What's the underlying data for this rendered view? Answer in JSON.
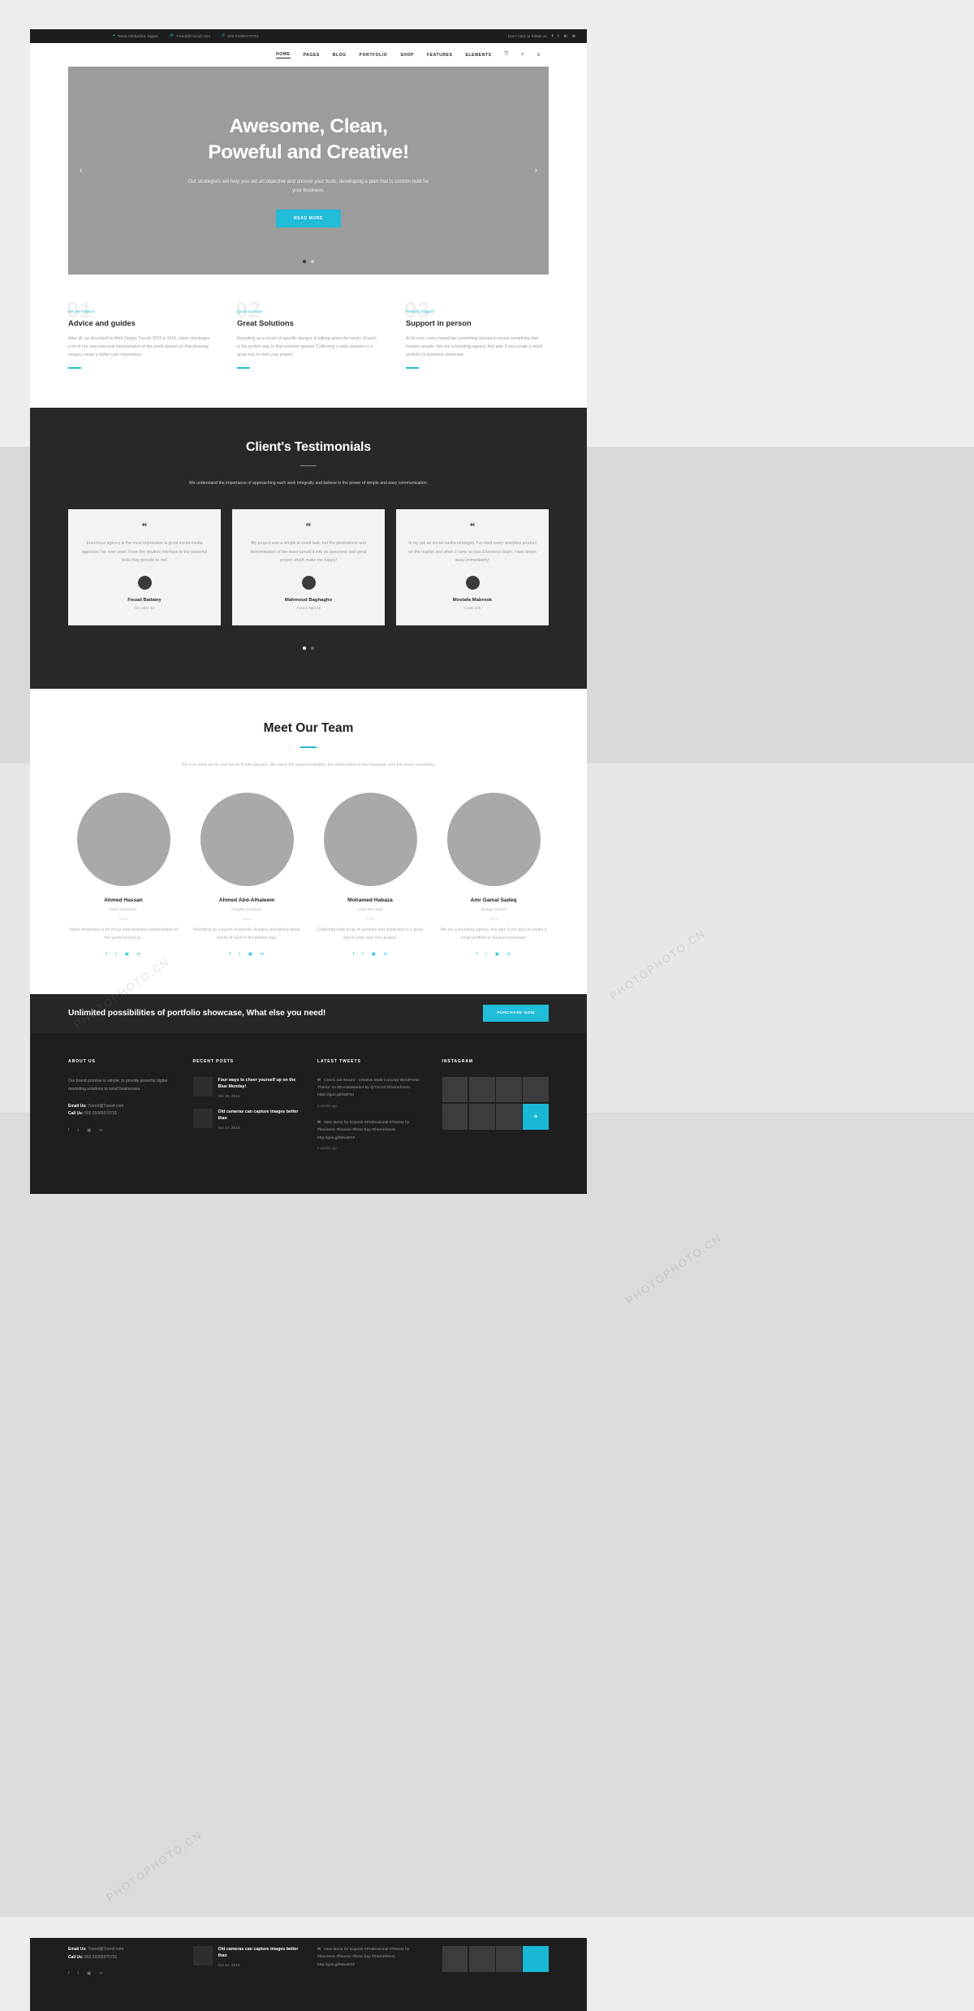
{
  "topbar": {
    "location": "Tanta AlGharbia, Egypt.",
    "email": "7oroof@7oroof.com",
    "phone": "002 01065370701",
    "follow_label": "Don't miss to follow us",
    "socials": [
      "f",
      "t",
      "in",
      "❈"
    ],
    "icons": {
      "pin": "⌖",
      "mail": "✉",
      "phone": "✆"
    }
  },
  "nav": {
    "items": [
      {
        "label": "HOME",
        "active": true
      },
      {
        "label": "PAGES",
        "active": false
      },
      {
        "label": "BLOG",
        "active": false
      },
      {
        "label": "PORTFOLIO",
        "active": false
      },
      {
        "label": "SHOP",
        "active": false
      },
      {
        "label": "FEATURES",
        "active": false
      },
      {
        "label": "ELEMENTS",
        "active": false
      }
    ],
    "cart_icon": "⛉",
    "search_icon": "⌕",
    "menu_icon": "≡"
  },
  "hero": {
    "title_line1": "Awesome, Clean,",
    "title_line2": "Poweful and Creative!",
    "subtitle": "Our strategists will help you set an objective and choose your tools, developing a plan that is custom-built for your business.",
    "button": "READ MORE",
    "arrow_prev": "‹",
    "arrow_next": "›",
    "dots": 2,
    "active_dot": 0,
    "accent": "#21bcd8"
  },
  "features": [
    {
      "number": "01",
      "tag": "We are helpers",
      "title": "Advice and guides",
      "text": "After all, as described in Web Design Trends 2015 & 2016, vision dominates a lot of our subconscious interpretation of the world around us that pleasing images create a better user experience."
    },
    {
      "number": "02",
      "tag": "Quick & smart",
      "title": "Great Solutions",
      "text": "Rounding up a bunch of specific designs & talking about the merits of each is the perfect way to find common ground. Collecting a wide samples is a great way to start your project."
    },
    {
      "number": "03",
      "tag": "Friendly support",
      "title": "Support in person",
      "text": "At its core, every brand has something special to reveal something that inspires people. We are a branding agency, this plan if you create a small portfolio or business showcase."
    }
  ],
  "testimonials": {
    "heading": "Client's Testimonials",
    "subtitle": "We understand the importance of approaching each work integrally and believe in the power of simple and easy communication.",
    "quote_glyph": "“",
    "cards": [
      {
        "text": "Enormous agency is the most impressive & great social media agencies I've ever seen. From the intuitive interface to the powerful tools they provide to me!",
        "name": "Fouad Badawy",
        "role": "Tie Labs Inc"
      },
      {
        "text": "My project was a simple & small task, but the persistence and determination of the team turned it into an awesome and great project which make me happy!",
        "name": "Mahmoud Baghagho",
        "role": "7oroof Agency"
      },
      {
        "text": "In my job as social media strategist, I've tried every analytics product on the market and when I came across Enormous team, I was blown away immediately!",
        "name": "Mostafa Mabrook",
        "role": "Code 125"
      }
    ],
    "dots": 2,
    "active_dot": 0
  },
  "team": {
    "heading": "Meet Our Team",
    "subtitle": "We love what we do and we do it with passion. We value the experimentation, the reformation of the message, and the smart incentives.",
    "members": [
      {
        "name": "Ahmed Hassan",
        "job": "Web developer",
        "bio": "Vision dominates a lot of our subconscious interpretation of the world around us."
      },
      {
        "name": "Ahmed Abd-Alhaleem",
        "job": "Graphic Designer",
        "bio": "Rounding up a bunch of specific designs and talking about merits of each is the perfect way."
      },
      {
        "name": "Mohamed Habaza",
        "job": "Lead Dev Ops",
        "bio": "Collecting wide array of samples and inspiration is a great way to start your next project."
      },
      {
        "name": "Amr Gamal Sadeq",
        "job": "Design Expert",
        "bio": "We are a branding agency, this plan if you plan to create a small portfolio or busines showcase"
      }
    ],
    "socials": [
      "f",
      "t",
      "▣",
      "in"
    ]
  },
  "cta": {
    "text": "Unlimited possibilities of portfolio showcase, What else you need!",
    "button": "PURCHASE NOW"
  },
  "footer": {
    "about": {
      "heading": "ABOUT US",
      "text": "Our brand promise is simple: to provide powerful digital marketing solutions to small businesses.",
      "email_label": "Email Us:",
      "email": "7oroof@7oroof.com",
      "call_label": "Call Us:",
      "phone": "002 01065370701",
      "socials": [
        "f",
        "t",
        "▣",
        "in"
      ]
    },
    "recent": {
      "heading": "RECENT POSTS",
      "posts": [
        {
          "title": "Four ways to cheer yourself up on the Blue Monday!",
          "date": "Oct 15, 2016"
        },
        {
          "title": "Old cameras can capture images better than",
          "date": "Oct 17, 2016"
        }
      ]
    },
    "tweets": {
      "heading": "LATEST TWEETS",
      "icon": "✉",
      "items": [
        {
          "text": "Check out 'Mount - Creative Multi-Concept WordPress Theme' on #EnvatoMarket by @7oroof #themeforest https://goo.gl/StZF6J",
          "ago": "2 weeks ago"
        },
        {
          "text": "New demo for Experts #Professional #Theme for #business #finance #firms buy #themeforest http://goo.gl/MwvBXF",
          "ago": "2 weeks ago"
        }
      ]
    },
    "instagram": {
      "heading": "INSTAGRAM",
      "tiles": 8,
      "highlight_index": 7,
      "highlight_glyph": "✦",
      "highlight_color": "#19b9d6"
    }
  },
  "watermarks": [
    "PHOTOPHOTO.CN",
    "PHOTOPHOTO.CN",
    "PHOTOPHOTO.CN",
    "PHOTOPHOTO.CN"
  ]
}
